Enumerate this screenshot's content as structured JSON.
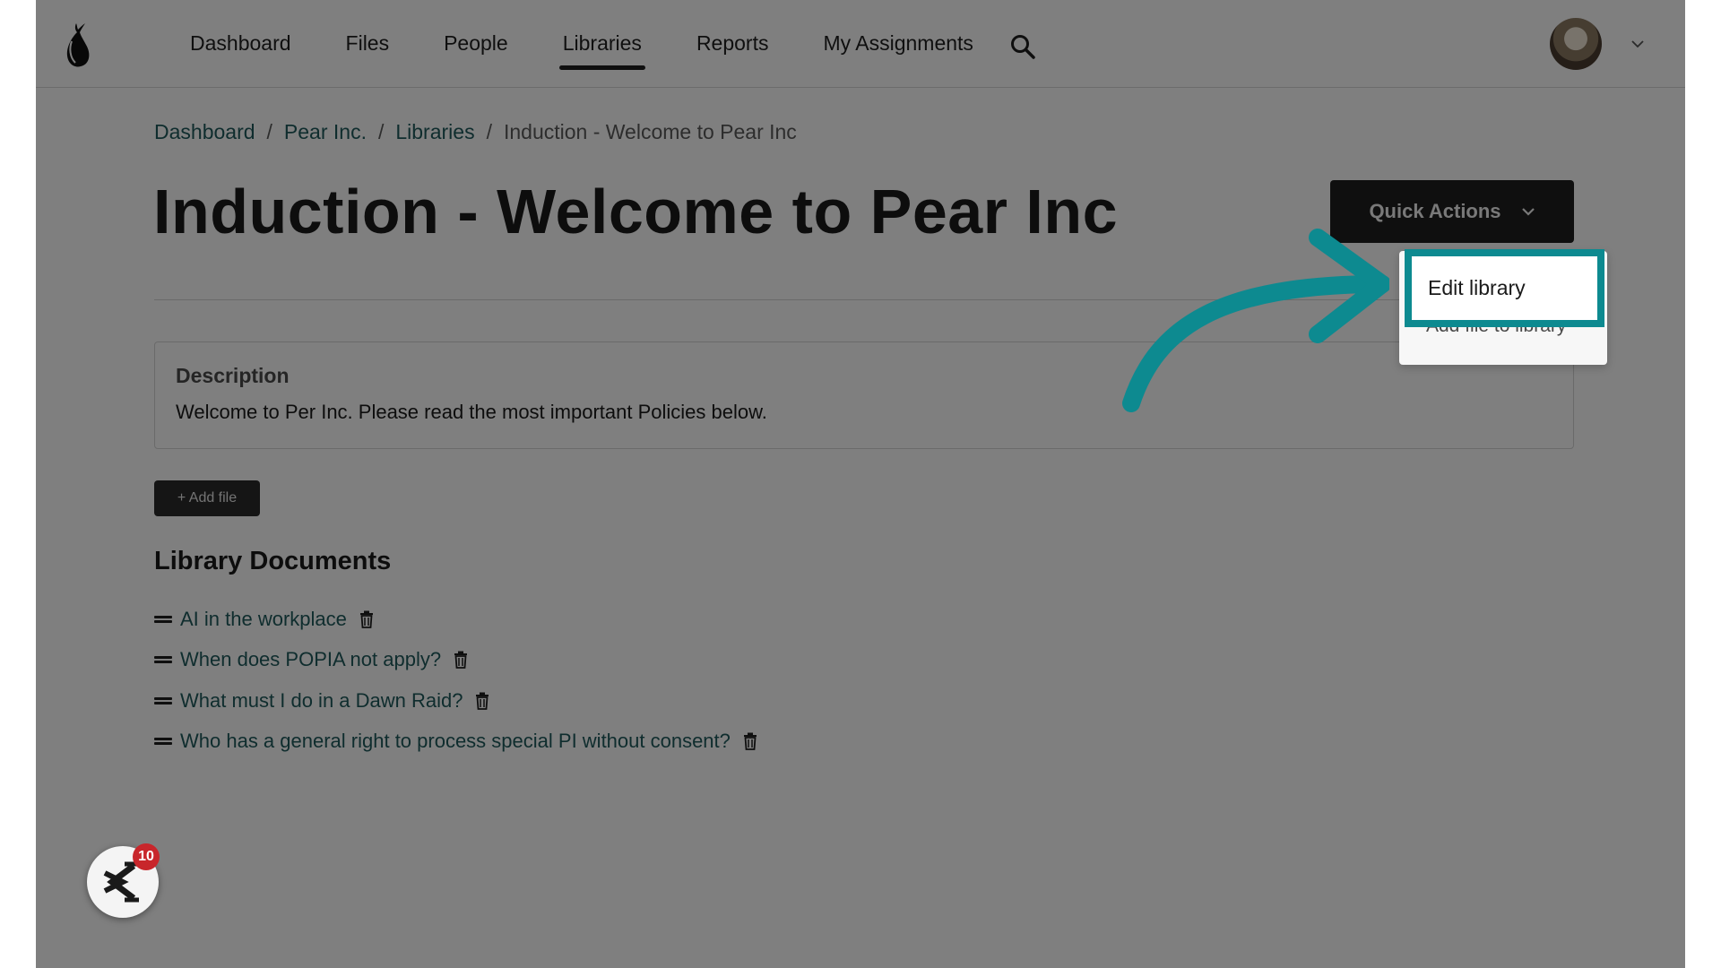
{
  "nav": {
    "items": [
      {
        "label": "Dashboard"
      },
      {
        "label": "Files"
      },
      {
        "label": "People"
      },
      {
        "label": "Libraries"
      },
      {
        "label": "Reports"
      },
      {
        "label": "My Assignments"
      }
    ],
    "active": "Libraries"
  },
  "breadcrumb": {
    "items": [
      "Dashboard",
      "Pear Inc.",
      "Libraries"
    ],
    "separator": "/",
    "current": "Induction - Welcome to Pear Inc"
  },
  "page": {
    "title": "Induction - Welcome to Pear Inc",
    "quick_actions_label": "Quick Actions"
  },
  "dropdown": {
    "items": [
      "Edit library",
      "Add file to library"
    ],
    "highlighted": "Edit library"
  },
  "description": {
    "label": "Description",
    "text": "Welcome to Per Inc. Please read the most important Policies below."
  },
  "add_file_label": "+ Add file",
  "documents": {
    "heading": "Library Documents",
    "items": [
      "AI in the workplace",
      "When does POPIA not apply?",
      "What must I do in a Dawn Raid?",
      "Who has a general right to process special PI without consent?"
    ]
  },
  "widget": {
    "badge_count": "10"
  },
  "colors": {
    "link": "#1f5a5c",
    "highlight": "#0d8a90",
    "badge": "#c8262b",
    "dark_button": "#1f1f1f"
  }
}
